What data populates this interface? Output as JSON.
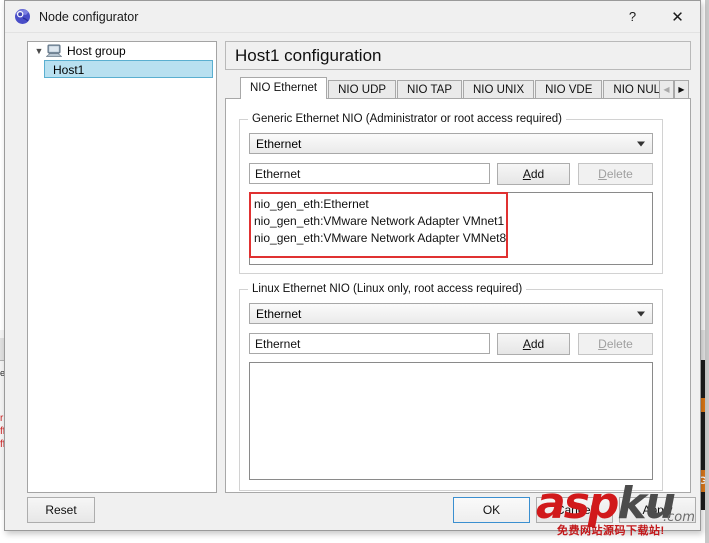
{
  "window": {
    "title": "Node configurator",
    "icon": "globe-icon",
    "help_label": "?",
    "close_label": "✕"
  },
  "tree": {
    "root": {
      "label": "Host group",
      "chevron": "chevron-down-icon",
      "icon": "computer-icon",
      "expanded": true
    },
    "children": [
      {
        "label": "Host1",
        "selected": true
      }
    ]
  },
  "config": {
    "header_title": "Host1 configuration",
    "tabs": [
      {
        "label": "NIO Ethernet",
        "active": true
      },
      {
        "label": "NIO UDP",
        "active": false
      },
      {
        "label": "NIO TAP",
        "active": false
      },
      {
        "label": "NIO UNIX",
        "active": false
      },
      {
        "label": "NIO VDE",
        "active": false
      },
      {
        "label": "NIO NULL",
        "active": false
      }
    ],
    "tab_scroll_left": "◀",
    "tab_scroll_right": "▶",
    "groups": [
      {
        "title": "Generic Ethernet NIO (Administrator or root access required)",
        "combo_value": "Ethernet",
        "input_value": "Ethernet",
        "add_label": "Add",
        "add_accel": "A",
        "add_rest": "dd",
        "delete_label": "Delete",
        "delete_accel": "D",
        "delete_rest": "elete",
        "delete_disabled": true,
        "items": [
          "nio_gen_eth:Ethernet",
          "nio_gen_eth:VMware Network Adapter VMnet1",
          "nio_gen_eth:VMware Network Adapter VMNet8"
        ]
      },
      {
        "title": "Linux Ethernet NIO (Linux only, root access required)",
        "combo_value": "Ethernet",
        "input_value": "Ethernet",
        "add_label": "Add",
        "add_accel": "A",
        "add_rest": "dd",
        "delete_label": "Delete",
        "delete_accel": "D",
        "delete_rest": "elete",
        "delete_disabled": true,
        "items": []
      }
    ]
  },
  "footer": {
    "reset_label": "Reset",
    "ok_label": "OK",
    "cancel_label": "Cancel",
    "apply_label": "Apply"
  },
  "watermark": {
    "part_red": "asp",
    "part_grey": "ku",
    "domain": ".com",
    "tagline": "免费网站源码下载站!"
  },
  "backdrop": {
    "left_text": "er",
    "left_red": "rr\nff\nff",
    "right_badge": "G"
  },
  "colors": {
    "selection": "#b8e0f0",
    "annotation": "#e03131",
    "accent": "#3a8fd0",
    "watermark_red": "#d1191b"
  }
}
